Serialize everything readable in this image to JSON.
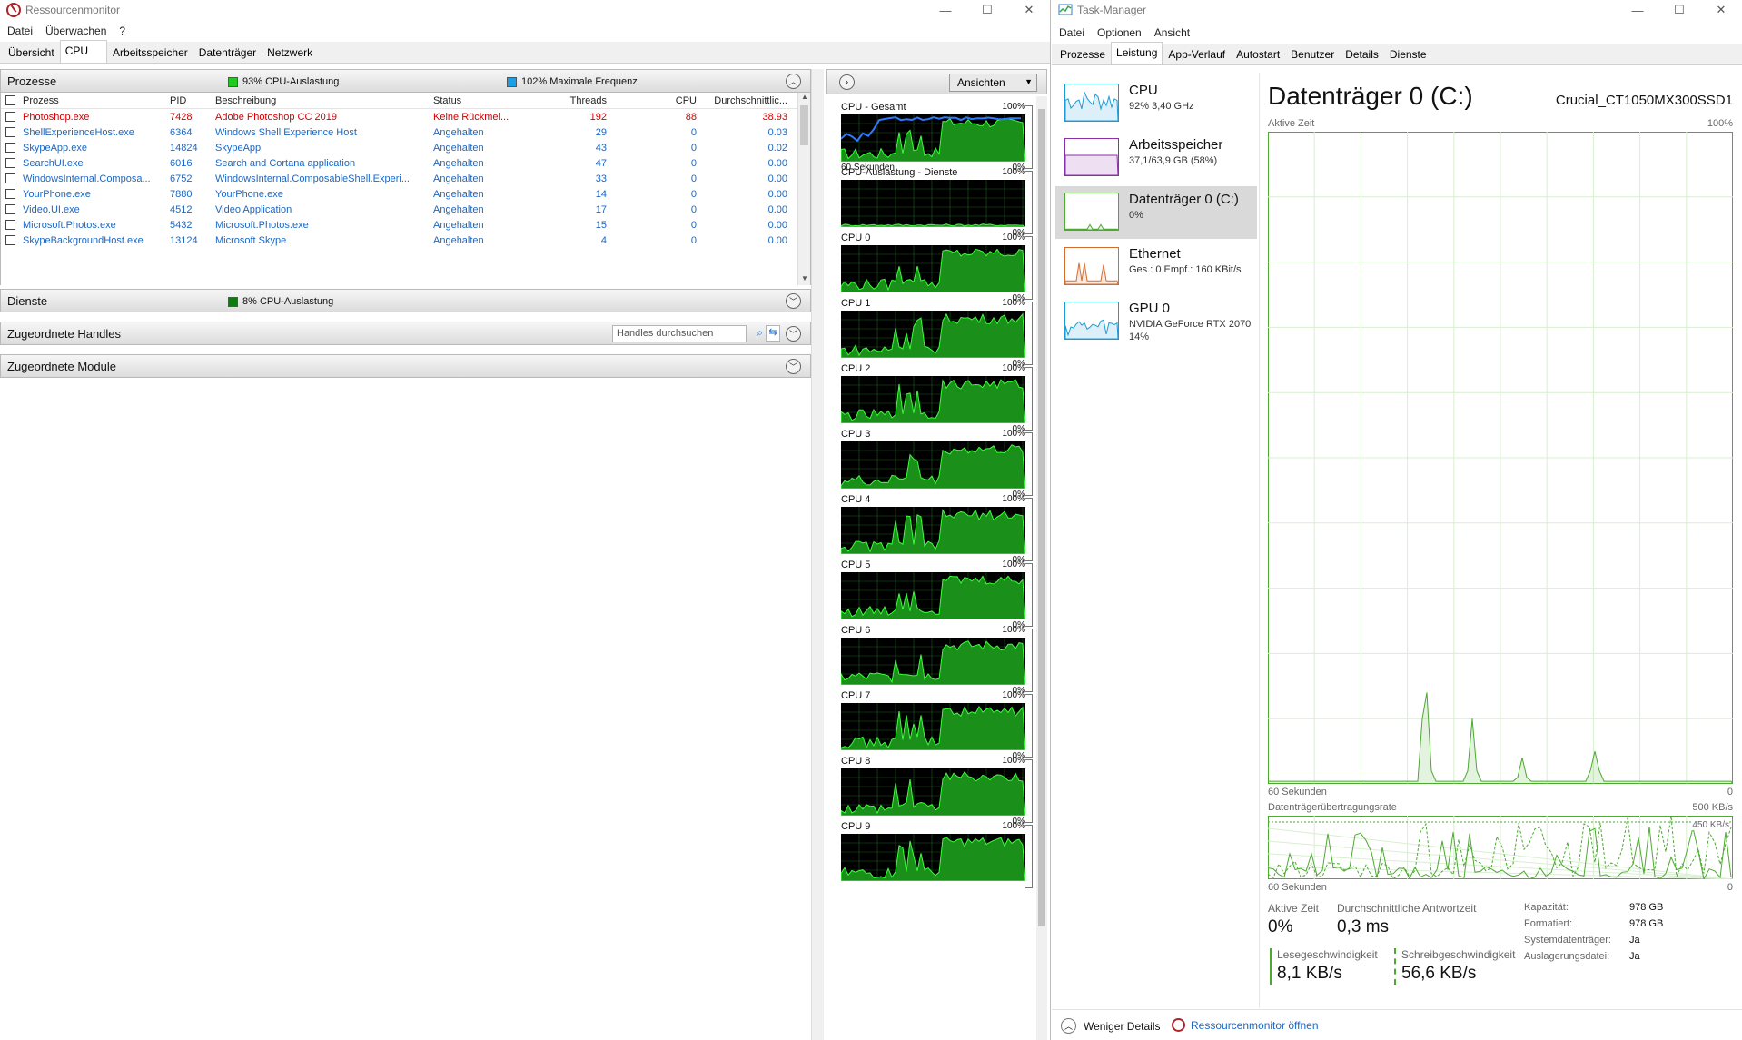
{
  "resmon": {
    "title": "Ressourcenmonitor",
    "menu": [
      "Datei",
      "Überwachen",
      "?"
    ],
    "tabs": [
      "Übersicht",
      "CPU",
      "Arbeitsspeicher",
      "Datenträger",
      "Netzwerk"
    ],
    "active_tab": "CPU",
    "processes": {
      "title": "Prozesse",
      "cpu_usage": "93% CPU-Auslastung",
      "cpu_usage_color": "#1ecb1e",
      "max_freq": "102% Maximale Frequenz",
      "max_freq_color": "#1aa0e8",
      "columns": [
        "Prozess",
        "PID",
        "Beschreibung",
        "Status",
        "Threads",
        "CPU",
        "Durchschnittlic..."
      ],
      "rows": [
        {
          "name": "Photoshop.exe",
          "pid": "7428",
          "desc": "Adobe Photoshop CC 2019",
          "status": "Keine Rückmel...",
          "threads": "192",
          "cpu": "88",
          "avg": "38.93",
          "color": "red"
        },
        {
          "name": "ShellExperienceHost.exe",
          "pid": "6364",
          "desc": "Windows Shell Experience Host",
          "status": "Angehalten",
          "threads": "29",
          "cpu": "0",
          "avg": "0.03",
          "color": "blue"
        },
        {
          "name": "SkypeApp.exe",
          "pid": "14824",
          "desc": "SkypeApp",
          "status": "Angehalten",
          "threads": "43",
          "cpu": "0",
          "avg": "0.02",
          "color": "blue"
        },
        {
          "name": "SearchUI.exe",
          "pid": "6016",
          "desc": "Search and Cortana application",
          "status": "Angehalten",
          "threads": "47",
          "cpu": "0",
          "avg": "0.00",
          "color": "blue"
        },
        {
          "name": "WindowsInternal.Composa...",
          "pid": "6752",
          "desc": "WindowsInternal.ComposableShell.Experi...",
          "status": "Angehalten",
          "threads": "33",
          "cpu": "0",
          "avg": "0.00",
          "color": "blue"
        },
        {
          "name": "YourPhone.exe",
          "pid": "7880",
          "desc": "YourPhone.exe",
          "status": "Angehalten",
          "threads": "14",
          "cpu": "0",
          "avg": "0.00",
          "color": "blue"
        },
        {
          "name": "Video.UI.exe",
          "pid": "4512",
          "desc": "Video Application",
          "status": "Angehalten",
          "threads": "17",
          "cpu": "0",
          "avg": "0.00",
          "color": "blue"
        },
        {
          "name": "Microsoft.Photos.exe",
          "pid": "5432",
          "desc": "Microsoft.Photos.exe",
          "status": "Angehalten",
          "threads": "15",
          "cpu": "0",
          "avg": "0.00",
          "color": "blue"
        },
        {
          "name": "SkypeBackgroundHost.exe",
          "pid": "13124",
          "desc": "Microsoft Skype",
          "status": "Angehalten",
          "threads": "4",
          "cpu": "0",
          "avg": "0.00",
          "color": "blue"
        }
      ]
    },
    "services": {
      "title": "Dienste",
      "cpu_usage": "8% CPU-Auslastung",
      "cpu_usage_color": "#0f7a0f"
    },
    "handles": {
      "title": "Zugeordnete Handles",
      "search_placeholder": "Handles durchsuchen"
    },
    "modules": {
      "title": "Zugeordnete Module"
    },
    "graphs": {
      "view_label": "Ansichten",
      "items": [
        {
          "label": "CPU - Gesamt",
          "max": "100%",
          "min": "0%",
          "time": "60 Sekunden",
          "blue": true
        },
        {
          "label": "CPU-Auslastung - Dienste",
          "max": "100%",
          "min": "0%",
          "time": "",
          "blue": false,
          "low": true
        },
        {
          "label": "CPU 0",
          "max": "100%",
          "min": "0%",
          "time": ""
        },
        {
          "label": "CPU 1",
          "max": "100%",
          "min": "0%",
          "time": ""
        },
        {
          "label": "CPU 2",
          "max": "100%",
          "min": "0%",
          "time": ""
        },
        {
          "label": "CPU 3",
          "max": "100%",
          "min": "0%",
          "time": ""
        },
        {
          "label": "CPU 4",
          "max": "100%",
          "min": "0%",
          "time": ""
        },
        {
          "label": "CPU 5",
          "max": "100%",
          "min": "0%",
          "time": ""
        },
        {
          "label": "CPU 6",
          "max": "100%",
          "min": "0%",
          "time": ""
        },
        {
          "label": "CPU 7",
          "max": "100%",
          "min": "0%",
          "time": ""
        },
        {
          "label": "CPU 8",
          "max": "100%",
          "min": "0%",
          "time": ""
        },
        {
          "label": "CPU 9",
          "max": "100%",
          "min": "",
          "time": ""
        }
      ]
    }
  },
  "taskmgr": {
    "title": "Task-Manager",
    "menu": [
      "Datei",
      "Optionen",
      "Ansicht"
    ],
    "tabs": [
      "Prozesse",
      "Leistung",
      "App-Verlauf",
      "Autostart",
      "Benutzer",
      "Details",
      "Dienste"
    ],
    "active_tab": "Leistung",
    "side": [
      {
        "title": "CPU",
        "sub": "92% 3,40 GHz",
        "color": "#1a9bd7"
      },
      {
        "title": "Arbeitsspeicher",
        "sub": "37,1/63,9 GB (58%)",
        "color": "#8b2fa8"
      },
      {
        "title": "Datenträger 0 (C:)",
        "sub": "0%",
        "color": "#4caa30"
      },
      {
        "title": "Ethernet",
        "sub": "Ges.: 0 Empf.: 160 KBit/s",
        "color": "#d36c2c"
      },
      {
        "title": "GPU 0",
        "sub": "NVIDIA GeForce RTX 2070",
        "sub2": "14%",
        "color": "#1a9bd7"
      }
    ],
    "main": {
      "title": "Datenträger 0 (C:)",
      "model": "Crucial_CT1050MX300SSD1",
      "active_time_label": "Aktive Zeit",
      "active_time_max": "100%",
      "time_label": "60 Sekunden",
      "zero": "0",
      "rate_label": "Datenträgerübertragungsrate",
      "rate_max": "500 KB/s",
      "rate_sub": "450 KB/s",
      "stats": {
        "active_label": "Aktive Zeit",
        "active_value": "0%",
        "resp_label": "Durchschnittliche Antwortzeit",
        "resp_value": "0,3 ms",
        "read_label": "Lesegeschwindigkeit",
        "read_value": "8,1 KB/s",
        "write_label": "Schreibgeschwindigkeit",
        "write_value": "56,6 KB/s"
      },
      "info": [
        {
          "key": "Kapazität:",
          "value": "978 GB"
        },
        {
          "key": "Formatiert:",
          "value": "978 GB"
        },
        {
          "key": "Systemdatenträger:",
          "value": "Ja"
        },
        {
          "key": "Auslagerungsdatei:",
          "value": "Ja"
        }
      ]
    },
    "footer": {
      "less": "Weniger Details",
      "open": "Ressourcenmonitor öffnen"
    }
  }
}
